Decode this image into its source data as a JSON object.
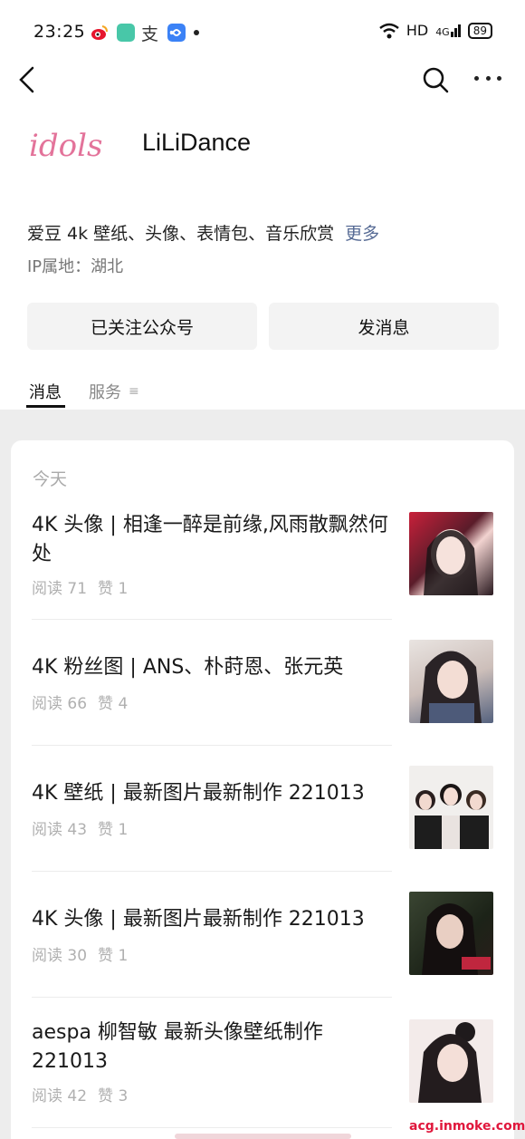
{
  "status_bar": {
    "time": "23:25",
    "text_icon": "支",
    "right_text": "HD",
    "signal": "4G",
    "battery": "89"
  },
  "account": {
    "logo_text": "idols",
    "name": "LiLiDance",
    "description": "爱豆 4k 壁纸、头像、表情包、音乐欣赏",
    "more_link": "更多",
    "ip_location": "IP属地：湖北"
  },
  "buttons": {
    "follow": "已关注公众号",
    "message": "发消息"
  },
  "tabs": {
    "messages": "消息",
    "services": "服务",
    "services_icon": "≡"
  },
  "feed": {
    "date_header": "今天",
    "articles": [
      {
        "title": "4K 头像 | 相逢一醉是前缘,风雨散飘然何处",
        "reads": "阅读 71",
        "likes": "赞 1",
        "thumb_colors": [
          "#d8233b",
          "#3a1c24"
        ]
      },
      {
        "title": "4K 粉丝图 | ANS、朴莳恩、张元英",
        "reads": "阅读 66",
        "likes": "赞 4",
        "thumb_colors": [
          "#d9cfcb",
          "#4e5b7a"
        ]
      },
      {
        "title": "4K 壁纸 | 最新图片最新制作 221013",
        "reads": "阅读 43",
        "likes": "赞 1",
        "thumb_colors": [
          "#f0eeec",
          "#1a1a1a"
        ]
      },
      {
        "title": "4K 头像 | 最新图片最新制作 221013",
        "reads": "阅读 30",
        "likes": "赞 1",
        "thumb_colors": [
          "#2e3a2a",
          "#b5233a"
        ]
      },
      {
        "title": "aespa 柳智敏 最新头像壁纸制作 221013",
        "reads": "阅读 42",
        "likes": "赞 3",
        "thumb_colors": [
          "#f3e9e8",
          "#2a2224"
        ]
      }
    ]
  },
  "watermark": "acg.inmoke.com"
}
